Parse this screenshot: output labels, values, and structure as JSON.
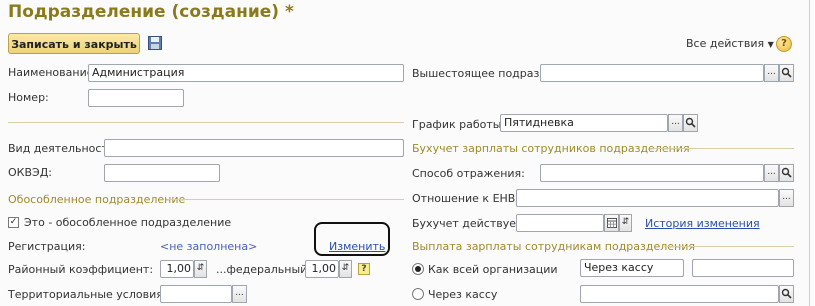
{
  "window": {
    "title": "Подразделение (создание) *"
  },
  "toolbar": {
    "save_close_label": "Записать и закрыть",
    "all_actions_label": "Все действия",
    "help_label": "?"
  },
  "left": {
    "name_label": "Наименование:",
    "name_value": "Администрация",
    "number_label": "Номер:",
    "number_value": "",
    "activity_label": "Вид деятельности:",
    "activity_value": "",
    "okved_label": "ОКВЭД:",
    "okved_value": "",
    "separate_section": "Обособленное подразделение",
    "separate_checkbox_label": "Это - обособленное подразделение",
    "separate_checked": true,
    "registration_label": "Регистрация:",
    "registration_value": "<не заполнена>",
    "change_link": "Изменить",
    "district_coef_label": "Районный коэффициент:",
    "district_coef_value": "1,00",
    "federal_label": "...федеральный:",
    "federal_value": "1,00",
    "territorial_label": "Территориальные условия:",
    "territorial_value": ""
  },
  "right": {
    "parent_label": "Вышестоящее подразд.:",
    "parent_value": "",
    "schedule_label": "График работы:",
    "schedule_value": "Пятидневка",
    "acc_section": "Бухучет зарплаты сотрудников подразделения",
    "reflect_label": "Способ отражения:",
    "reflect_value": "",
    "envd_label": "Отношение к ЕНВД:",
    "envd_value": "",
    "acc_valid_label": "Бухучет действует с:",
    "acc_valid_value": "",
    "history_link": "История изменения",
    "pay_section": "Выплата зарплаты сотрудникам подразделения",
    "radio_whole_org_label": "Как всей организации",
    "radio_whole_org_value": "Через кассу",
    "radio_cash_label": "Через кассу",
    "selected_radio": "whole_org"
  },
  "icons": {
    "search": "magnifier-icon",
    "ellipsis": "ellipsis-icon",
    "spin": "spinner-icon",
    "calendar": "calendar-icon",
    "save": "floppy-disk-icon"
  },
  "colors": {
    "title": "#8a7a1c",
    "section": "#a08a2a",
    "link": "#2a4fb0",
    "button_bg": "#ecd27a"
  }
}
